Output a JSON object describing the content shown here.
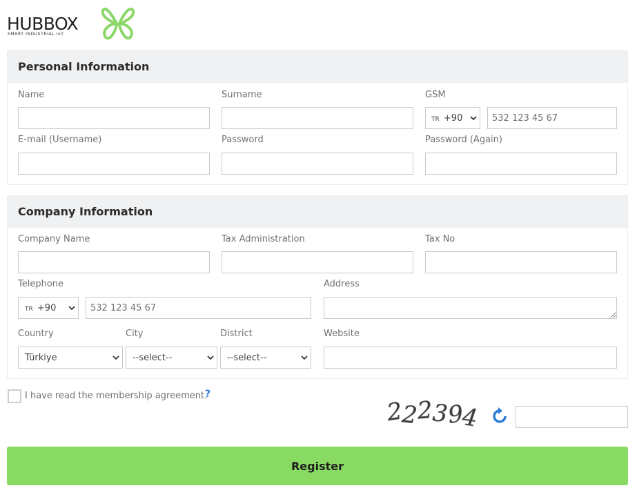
{
  "logo": {
    "name": "HUBBOX",
    "tagline": "SMART INDUSTRIAL IoT",
    "accent": "#8bd868"
  },
  "personal": {
    "title": "Personal Information",
    "name_label": "Name",
    "surname_label": "Surname",
    "gsm_label": "GSM",
    "gsm_country_flag": "TR",
    "gsm_code": "+90",
    "gsm_placeholder": "532 123 45 67",
    "email_label": "E-mail (Username)",
    "password_label": "Password",
    "password_again_label": "Password (Again)"
  },
  "company": {
    "title": "Company Information",
    "company_name_label": "Company Name",
    "tax_admin_label": "Tax Administration",
    "tax_no_label": "Tax No",
    "telephone_label": "Telephone",
    "phone_country_flag": "TR",
    "phone_code": "+90",
    "phone_placeholder": "532 123 45 67",
    "address_label": "Address",
    "country_label": "Country",
    "country_value": "Türkiye",
    "city_label": "City",
    "city_value": "--select--",
    "district_label": "District",
    "district_value": "--select--",
    "website_label": "Website"
  },
  "agreement": {
    "text": "I have read the membership agreement.",
    "help": "?"
  },
  "captcha": {
    "code": "222394"
  },
  "register_label": "Register",
  "colors": {
    "accent_green": "#89da63",
    "link_blue": "#2e7bd6",
    "section_bg": "#f0f1f2"
  }
}
